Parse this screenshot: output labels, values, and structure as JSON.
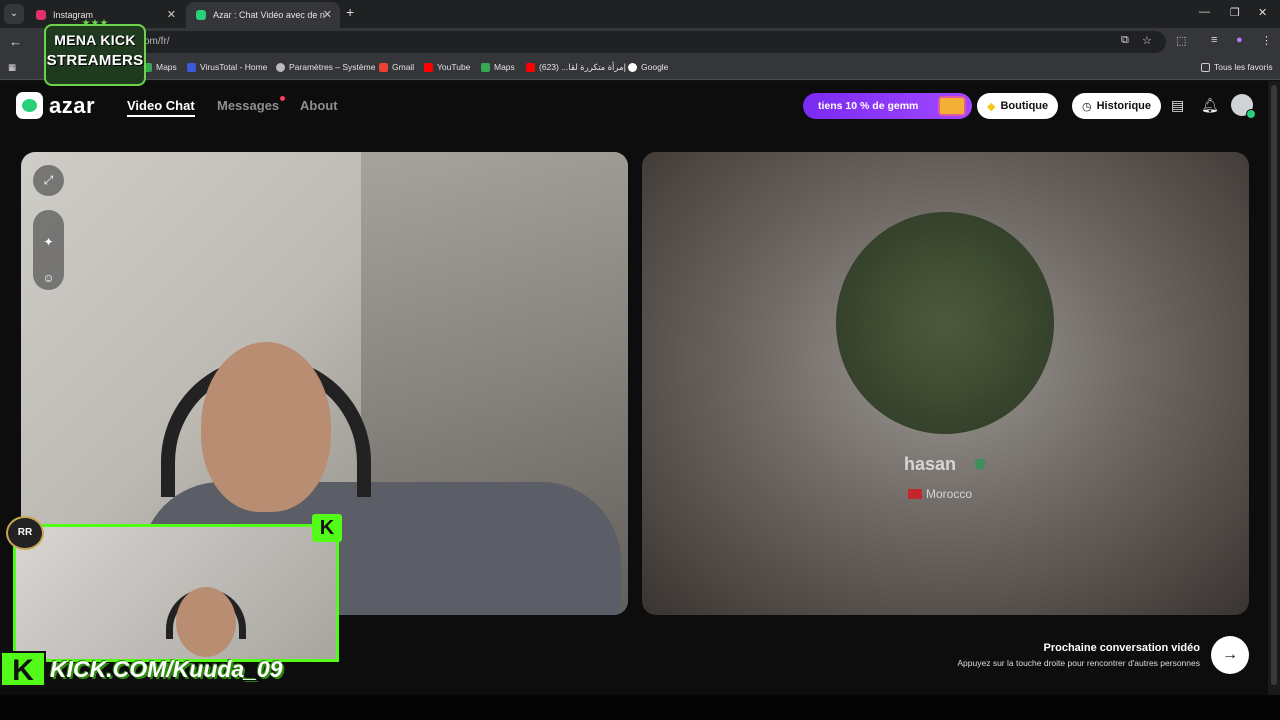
{
  "browser": {
    "tabs": [
      {
        "title": "Instagram",
        "icon": "instagram-icon",
        "color": "#e1306c"
      },
      {
        "title": "Azar : Chat Vidéo avec de n",
        "icon": "azar-icon",
        "color": "#27d07a"
      }
    ],
    "url_visible": "om/fr/",
    "bookmarks": [
      {
        "label": "Maps",
        "color": "#34a853"
      },
      {
        "label": "VirusTotal - Home",
        "color": "#3b5bdb"
      },
      {
        "label": "Paramètres – Système",
        "color": "#bbbbbb"
      },
      {
        "label": "Gmail",
        "color": "#ea4335"
      },
      {
        "label": "YouTube",
        "color": "#ff0000"
      },
      {
        "label": "Maps",
        "color": "#34a853"
      },
      {
        "label": "إمرأة متكررة لقا... (623)",
        "color": "#ff0000"
      },
      {
        "label": "Google",
        "color": "#ffffff"
      }
    ],
    "all_bookmarks_label": "Tous les favoris"
  },
  "app": {
    "logo_text": "azar",
    "nav": {
      "video_chat": "Video Chat",
      "messages": "Messages",
      "about": "About"
    },
    "promo_text": "tiens 10 % de gemm",
    "boutique_label": "Boutique",
    "historique_label": "Historique",
    "peer": {
      "name": "hasan",
      "country": "Morocco"
    },
    "next": {
      "title": "Prochaine conversation vidéo",
      "subtitle": "Appuyez sur la touche droite pour rencontrer d'autres personnes"
    },
    "accent_color": "#27d07a"
  },
  "overlay": {
    "logo_line1": "MENA KICK",
    "logo_line2": "STREAMERS",
    "logo_stars": "★★★",
    "kick_letter": "K",
    "kick_url": "KICK.COM/Kuuda_09",
    "kick_color": "#53fc18"
  }
}
